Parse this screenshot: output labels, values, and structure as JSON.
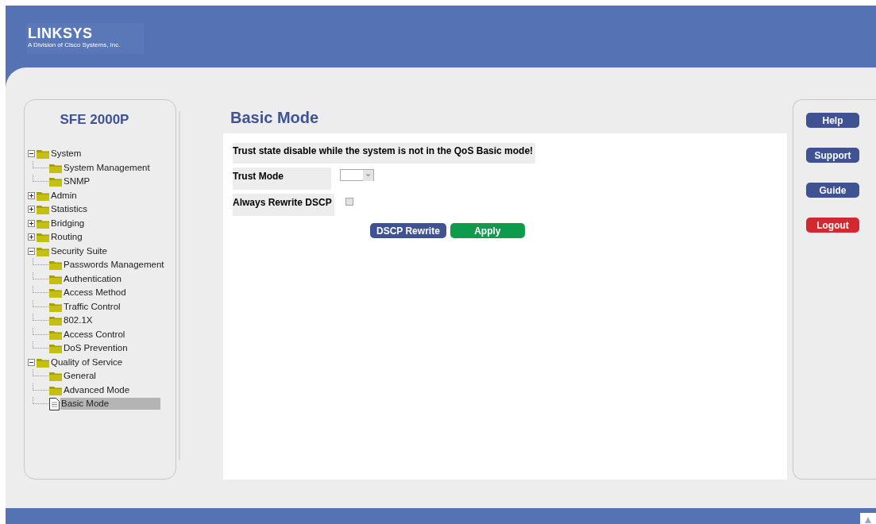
{
  "brand": {
    "logo": "LINKSYS",
    "tagline": "A Division of Cisco Systems, Inc."
  },
  "sidebar": {
    "title": "SFE 2000P",
    "tree": [
      {
        "label": "System",
        "kind": "folder",
        "expanded": true,
        "selected": false,
        "children": [
          {
            "label": "System Management",
            "kind": "folder",
            "selected": false
          },
          {
            "label": "SNMP",
            "kind": "folder",
            "selected": false
          }
        ]
      },
      {
        "label": "Admin",
        "kind": "folder",
        "expanded": false,
        "selected": false
      },
      {
        "label": "Statistics",
        "kind": "folder",
        "expanded": false,
        "selected": false
      },
      {
        "label": "Bridging",
        "kind": "folder",
        "expanded": false,
        "selected": false
      },
      {
        "label": "Routing",
        "kind": "folder",
        "expanded": false,
        "selected": false
      },
      {
        "label": "Security Suite",
        "kind": "folder",
        "expanded": true,
        "selected": false,
        "children": [
          {
            "label": "Passwords Management",
            "kind": "folder",
            "selected": false
          },
          {
            "label": "Authentication",
            "kind": "folder",
            "selected": false
          },
          {
            "label": "Access Method",
            "kind": "folder",
            "selected": false
          },
          {
            "label": "Traffic Control",
            "kind": "folder",
            "selected": false
          },
          {
            "label": "802.1X",
            "kind": "folder",
            "selected": false
          },
          {
            "label": "Access Control",
            "kind": "folder",
            "selected": false
          },
          {
            "label": "DoS Prevention",
            "kind": "folder",
            "selected": false
          }
        ]
      },
      {
        "label": "Quality of Service",
        "kind": "folder",
        "expanded": true,
        "selected": false,
        "children": [
          {
            "label": "General",
            "kind": "folder",
            "selected": false
          },
          {
            "label": "Advanced Mode",
            "kind": "folder",
            "selected": false
          },
          {
            "label": "Basic Mode",
            "kind": "page",
            "selected": true
          }
        ]
      }
    ]
  },
  "page": {
    "title": "Basic Mode",
    "notice": "Trust state disable while the system is not in the QoS Basic mode!",
    "fields": [
      {
        "kind": "select",
        "label": "Trust Mode",
        "disabled": true
      },
      {
        "kind": "checkbox",
        "label": "Always Rewrite DSCP",
        "checked": false,
        "disabled": true
      }
    ],
    "buttons": [
      {
        "label": "DSCP Rewrite",
        "color": "#3f5394"
      },
      {
        "label": "Apply",
        "color": "#0f9a4c"
      }
    ]
  },
  "side_buttons": [
    {
      "label": "Help",
      "color": "#3f5394"
    },
    {
      "label": "Support",
      "color": "#3f5394"
    },
    {
      "label": "Guide",
      "color": "#3f5394"
    },
    {
      "label": "Logout",
      "color": "#d2282f"
    }
  ]
}
